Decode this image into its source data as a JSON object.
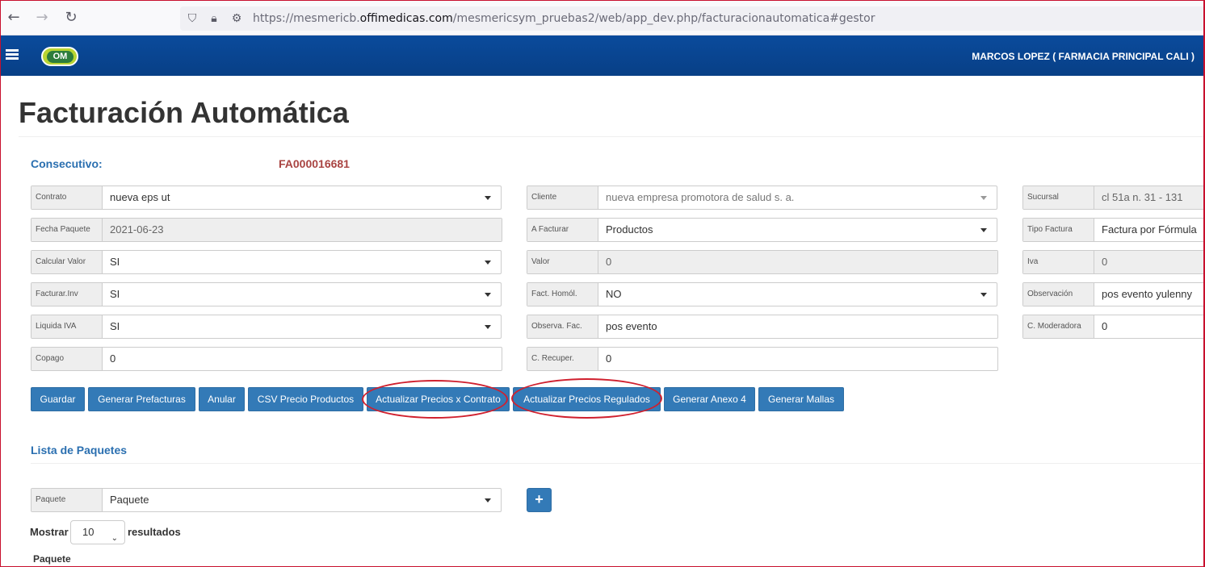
{
  "browser": {
    "back_icon": "arrow-left-icon",
    "forward_icon": "arrow-right-icon",
    "reload_icon": "reload-icon",
    "url_prefix": "https://mesmericb.",
    "url_domain": "offimedicas.com",
    "url_path": "/mesmericsym_pruebas2/web/app_dev.php/facturacionautomatica#gestor"
  },
  "header": {
    "logo_text": "OM",
    "user": "MARCOS LOPEZ ( FARMACIA PRINCIPAL CALI )"
  },
  "page": {
    "title": "Facturación Automática",
    "consecutivo_label": "Consecutivo:",
    "consecutivo_value": "FA000016681"
  },
  "form": {
    "contrato": {
      "label": "Contrato",
      "value": "nueva eps ut"
    },
    "fecha_paquete": {
      "label": "Fecha Paquete",
      "value": "2021-06-23"
    },
    "calcular_valor": {
      "label": "Calcular Valor",
      "value": "SI"
    },
    "facturar_inv": {
      "label": "Facturar.Inv",
      "value": "SI"
    },
    "liquida_iva": {
      "label": "Liquida IVA",
      "value": "SI"
    },
    "copago": {
      "label": "Copago",
      "value": "0"
    },
    "cliente": {
      "label": "Cliente",
      "value": "nueva empresa promotora de salud s. a."
    },
    "a_facturar": {
      "label": "A Facturar",
      "value": "Productos"
    },
    "valor": {
      "label": "Valor",
      "value": "0"
    },
    "fact_homol": {
      "label": "Fact. Homól.",
      "value": "NO"
    },
    "observa_fac": {
      "label": "Observa. Fac.",
      "value": "pos evento"
    },
    "c_recuper": {
      "label": "C. Recuper.",
      "value": "0"
    },
    "sucursal": {
      "label": "Sucursal",
      "value": "cl 51a n. 31 - 131"
    },
    "tipo_factura": {
      "label": "Tipo Factura",
      "value": "Factura por Fórmula"
    },
    "iva": {
      "label": "Iva",
      "value": "0"
    },
    "observacion": {
      "label": "Observación",
      "value": "pos evento yulenny"
    },
    "c_moderadora": {
      "label": "C. Moderadora",
      "value": "0"
    }
  },
  "actions": {
    "guardar": "Guardar",
    "generar_prefacturas": "Generar Prefacturas",
    "anular": "Anular",
    "csv_precio": "CSV Precio Productos",
    "actualizar_contrato": "Actualizar Precios x Contrato",
    "actualizar_regulados": "Actualizar Precios Regulados",
    "generar_anexo": "Generar Anexo 4",
    "generar_mallas": "Generar Mallas"
  },
  "paquetes": {
    "section_title": "Lista de Paquetes",
    "paquete_label": "Paquete",
    "paquete_value": "Paquete",
    "add_symbol": "+",
    "mostrar": "Mostrar",
    "page_length": "10",
    "resultados": "resultados",
    "column_paquete": "Paquete"
  }
}
